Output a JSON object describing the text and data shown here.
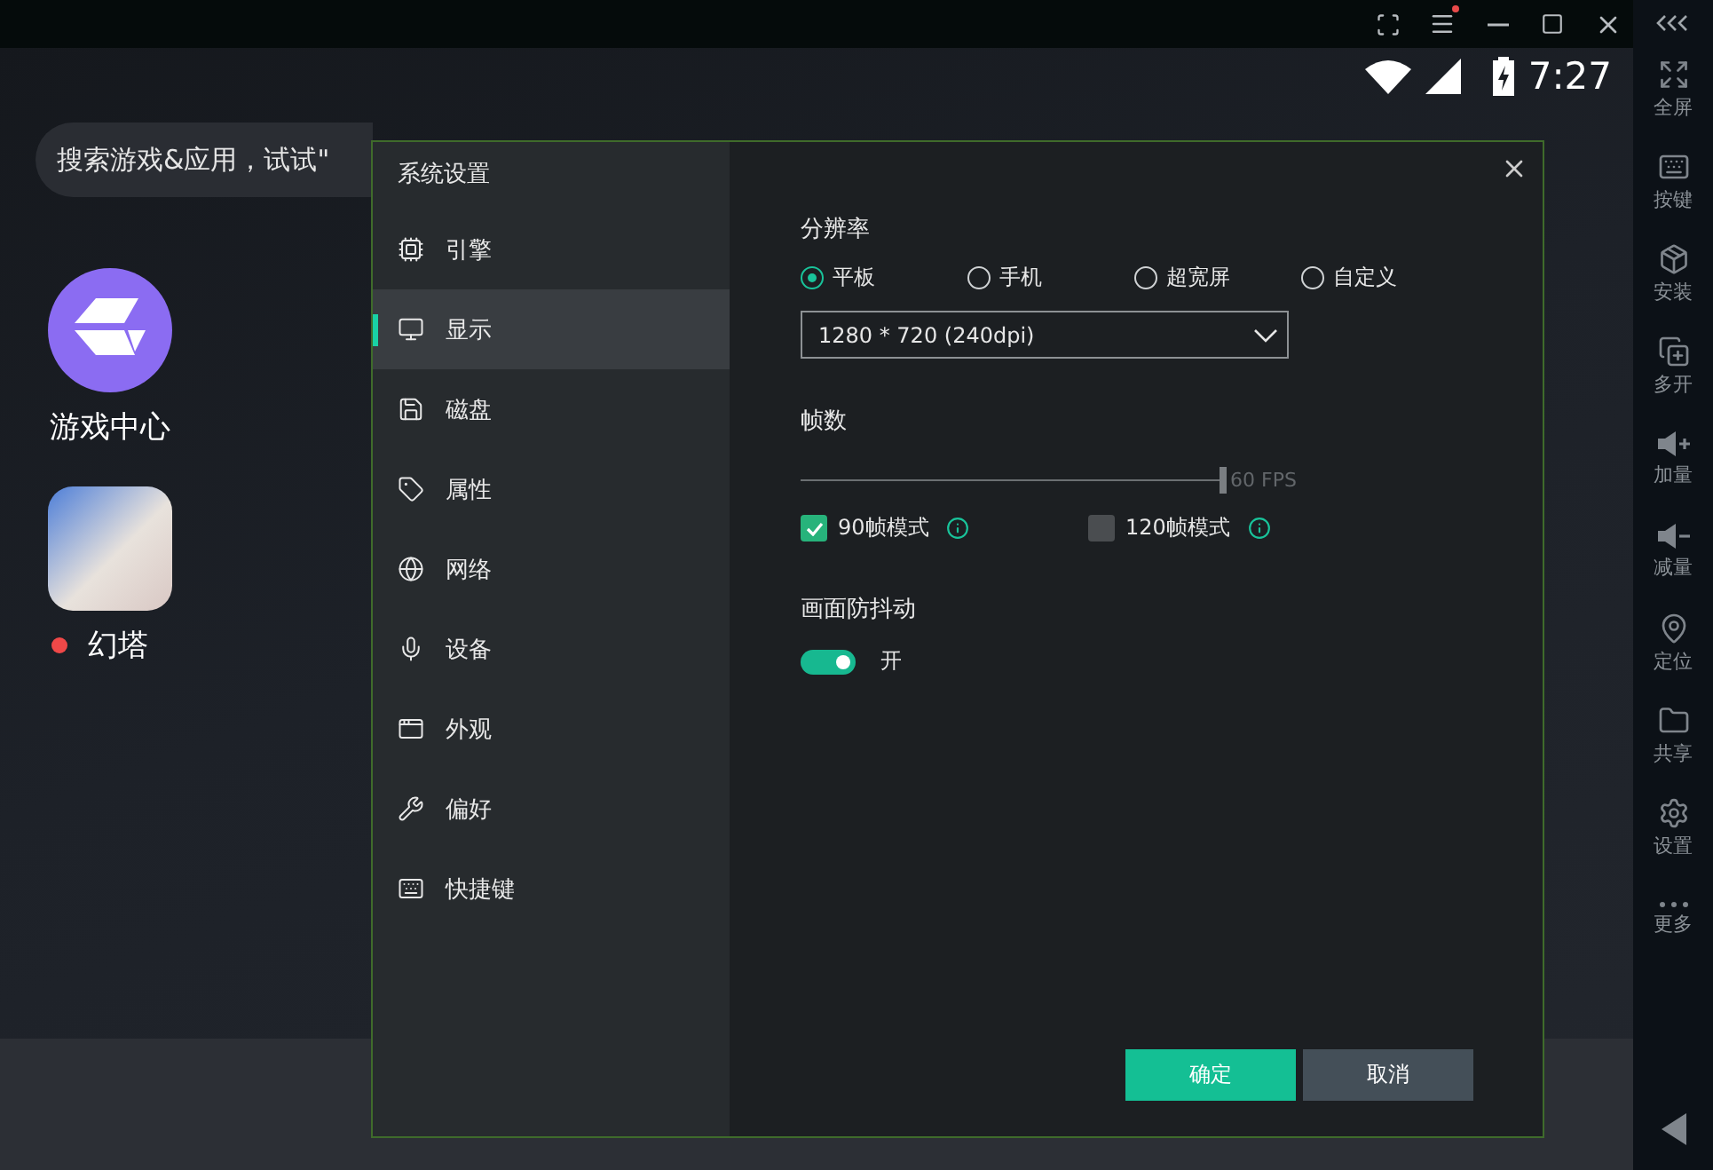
{
  "title_bar": {
    "menu_badge": true
  },
  "status_bar": {
    "time": "7:27"
  },
  "search": {
    "placeholder": "搜索游戏&应用，试试\""
  },
  "apps": [
    {
      "label": "游戏中心",
      "kind": "logo",
      "notify": false
    },
    {
      "label": "幻塔",
      "kind": "photo",
      "notify": true
    }
  ],
  "toolbar": [
    {
      "label": "全屏",
      "kind": "fullscreen"
    },
    {
      "label": "按键",
      "kind": "keys"
    },
    {
      "label": "安装",
      "kind": "install"
    },
    {
      "label": "多开",
      "kind": "multi"
    },
    {
      "label": "加量",
      "kind": "volup"
    },
    {
      "label": "减量",
      "kind": "voldown"
    },
    {
      "label": "定位",
      "kind": "location"
    },
    {
      "label": "共享",
      "kind": "share"
    },
    {
      "label": "设置",
      "kind": "settings"
    },
    {
      "label": "更多",
      "kind": "more"
    }
  ],
  "dialog": {
    "title": "系统设置",
    "nav": [
      {
        "label": "引擎",
        "kind": "cpu",
        "selected": false
      },
      {
        "label": "显示",
        "kind": "monitor",
        "selected": true
      },
      {
        "label": "磁盘",
        "kind": "disk",
        "selected": false
      },
      {
        "label": "属性",
        "kind": "tag",
        "selected": false
      },
      {
        "label": "网络",
        "kind": "globe",
        "selected": false
      },
      {
        "label": "设备",
        "kind": "device",
        "selected": false
      },
      {
        "label": "外观",
        "kind": "window",
        "selected": false
      },
      {
        "label": "偏好",
        "kind": "wrench",
        "selected": false
      },
      {
        "label": "快捷键",
        "kind": "keyboard",
        "selected": false
      }
    ],
    "resolution": {
      "label": "分辨率",
      "options": [
        {
          "label": "平板",
          "selected": true
        },
        {
          "label": "手机",
          "selected": false
        },
        {
          "label": "超宽屏",
          "selected": false
        },
        {
          "label": "自定义",
          "selected": false
        }
      ],
      "value": "1280 * 720 (240dpi)"
    },
    "fps": {
      "label": "帧数",
      "level": 1,
      "reading": "60 FPS",
      "modes": [
        {
          "label": "90帧模式",
          "checked": true
        },
        {
          "label": "120帧模式",
          "checked": false
        }
      ]
    },
    "stabilize": {
      "label": "画面防抖动",
      "on": true,
      "state_label": "开"
    },
    "buttons": [
      {
        "label": "确定",
        "kind": "primary"
      },
      {
        "label": "取消",
        "kind": "secondary"
      }
    ]
  }
}
